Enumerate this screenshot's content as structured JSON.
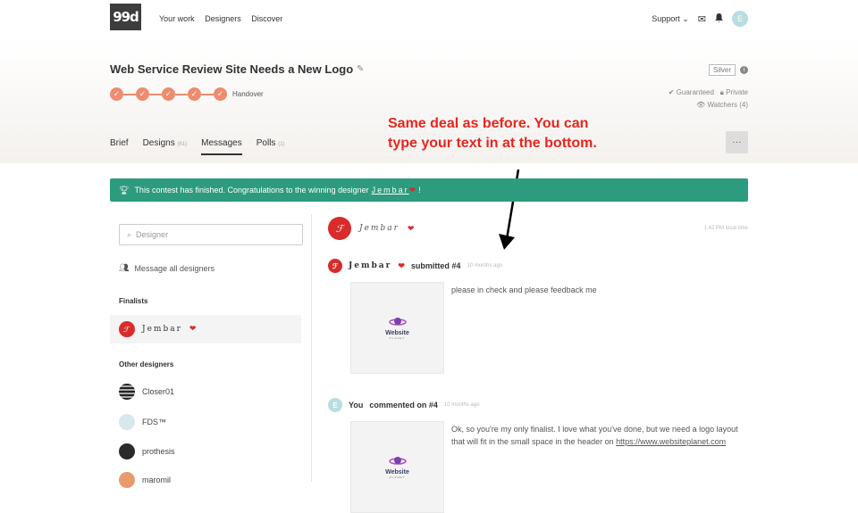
{
  "header": {
    "logo": "99d",
    "nav": [
      "Your work",
      "Designers",
      "Discover"
    ],
    "support": "Support",
    "user_initial": "E"
  },
  "contest": {
    "title": "Web Service Review Site Needs a New Logo",
    "steps_count": 5,
    "step_label": "Handover",
    "tier": "Silver",
    "guaranteed": "Guaranteed",
    "private": "Private",
    "watchers": "Watchers (4)"
  },
  "tabs": [
    {
      "label": "Brief",
      "count": ""
    },
    {
      "label": "Designs",
      "count": "(61)"
    },
    {
      "label": "Messages",
      "count": ""
    },
    {
      "label": "Polls",
      "count": "(1)"
    }
  ],
  "annotation": {
    "line1": "Same deal as before. You can",
    "line2": "type your text in at the bottom."
  },
  "banner": {
    "text": "This contest has finished. Congratulations to the winning designer",
    "winner": "Jembar",
    "suffix": "!"
  },
  "sidebar": {
    "search_placeholder": "Designer",
    "message_all": "Message all designers",
    "finalists_heading": "Finalists",
    "finalist_name": "Jembar",
    "others_heading": "Other designers",
    "others": [
      "Closer01",
      "FDS™",
      "prothesis",
      "maromil"
    ]
  },
  "chat": {
    "designer": "Jembar",
    "local_time": "1:42 PM local time",
    "entries": [
      {
        "author": "Jembar",
        "action": "submitted #4",
        "ago": "10 months ago",
        "text": "please in check and please feedback me"
      },
      {
        "author": "You",
        "action": "commented on #4",
        "ago": "10 months ago",
        "text": "Ok, so you're my only finalist. I love what you've done, but we need a logo layout that will fit in the small space in the header on",
        "link": "https://www.websiteplanet.com"
      }
    ],
    "thumb_brand": "Website",
    "thumb_brand2": "PLANET"
  },
  "colors": {
    "accent": "#ee8c6e",
    "banner": "#2d9b7e",
    "annotation": "#e8251e",
    "designer_avatar": "#d92b2b"
  }
}
